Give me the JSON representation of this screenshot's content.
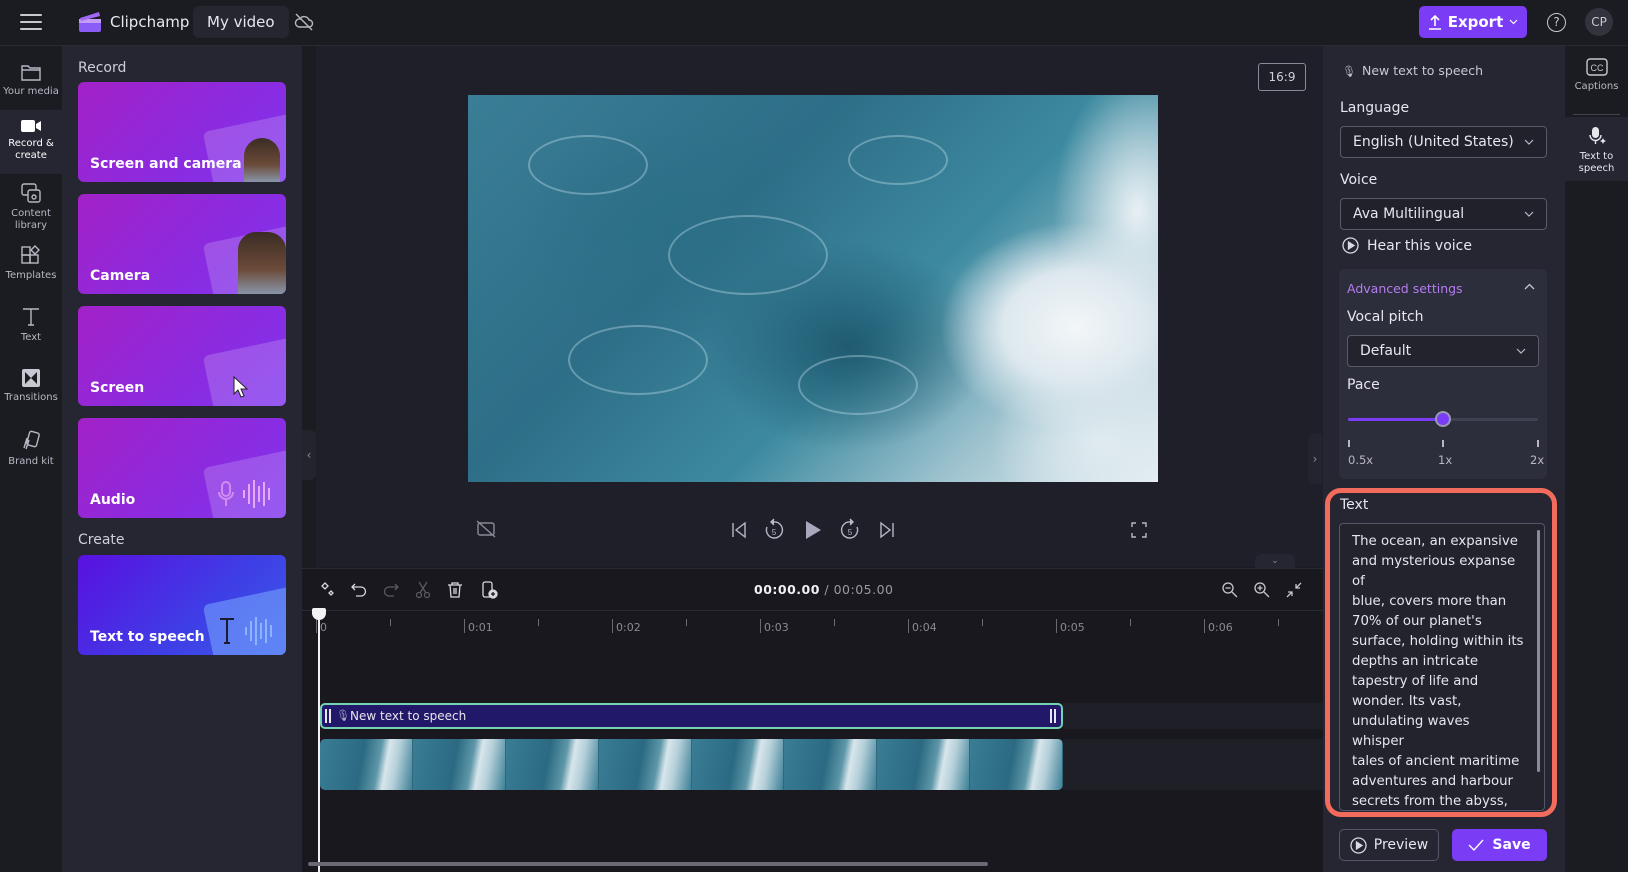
{
  "topbar": {
    "brand": "Clipchamp",
    "project_title": "My video",
    "export_label": "Export",
    "help_label": "?",
    "avatar_initials": "CP"
  },
  "left_rail": {
    "items": [
      {
        "label_1": "Your media",
        "label_2": "",
        "icon": "folder-icon"
      },
      {
        "label_1": "Record &",
        "label_2": "create",
        "icon": "video-camera-icon",
        "active": true
      },
      {
        "label_1": "Content",
        "label_2": "library",
        "icon": "content-library-icon"
      },
      {
        "label_1": "Templates",
        "label_2": "",
        "icon": "templates-icon"
      },
      {
        "label_1": "Text",
        "label_2": "",
        "icon": "text-icon"
      },
      {
        "label_1": "Transitions",
        "label_2": "",
        "icon": "transitions-icon"
      },
      {
        "label_1": "Brand kit",
        "label_2": "",
        "icon": "brand-kit-icon"
      }
    ]
  },
  "panel": {
    "record_heading": "Record",
    "create_heading": "Create",
    "record_cards": [
      {
        "label": "Screen and camera"
      },
      {
        "label": "Camera"
      },
      {
        "label": "Screen"
      },
      {
        "label": "Audio"
      }
    ],
    "create_cards": [
      {
        "label": "Text to speech"
      }
    ]
  },
  "stage": {
    "aspect_ratio": "16:9"
  },
  "timeline": {
    "current_time": "00:00.00",
    "separator": " / ",
    "total_time": "00:05.00",
    "ruler_labels": [
      "0",
      "0:01",
      "0:02",
      "0:03",
      "0:04",
      "0:05",
      "0:06"
    ],
    "tts_clip_label": "New text to speech",
    "video_thumbnail_count": 8
  },
  "properties": {
    "header": "New text to speech",
    "language_label": "Language",
    "language_value": "English (United States)",
    "voice_label": "Voice",
    "voice_value": "Ava Multilingual",
    "hear_voice_label": "Hear this voice",
    "advanced_label": "Advanced settings",
    "pitch_label": "Vocal pitch",
    "pitch_value": "Default",
    "pace_label": "Pace",
    "pace_ticks": [
      "0.5x",
      "1x",
      "2x"
    ],
    "pace_value_fraction": 0.5,
    "text_label": "Text",
    "text_value": "The ocean, an expansive\nand mysterious expanse of\nblue, covers more than\n70% of our planet's\nsurface, holding within its\ndepths an intricate\ntapestry of life and\nwonder. Its vast,\nundulating waves whisper\ntales of ancient maritime\nadventures and harbour\nsecrets from the abyss,\nwhile its shimmering\nsurface reflects the ever-",
    "preview_label": "Preview",
    "save_label": "Save"
  },
  "right_rail": {
    "items": [
      {
        "label_1": "Captions",
        "label_2": "",
        "icon": "captions-icon"
      },
      {
        "label_1": "Text to",
        "label_2": "speech",
        "icon": "text-to-speech-icon",
        "active": true
      }
    ]
  },
  "colors": {
    "accent": "#7b3cf5",
    "highlight_outline": "#f36b5d",
    "tts_clip_border": "#74d2b0",
    "advanced_link": "#b47cf0"
  }
}
